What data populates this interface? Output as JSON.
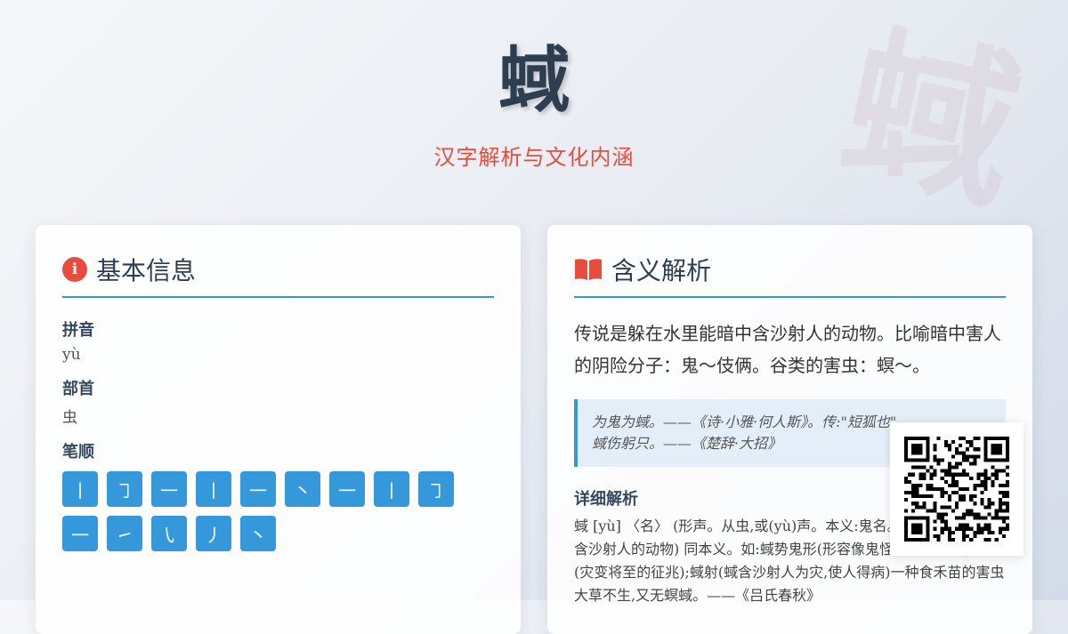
{
  "character": "蜮",
  "subtitle": "汉字解析与文化内涵",
  "colors": {
    "accent": "#3498db",
    "highlight": "#e74c3c",
    "text": "#2c3e50"
  },
  "basic": {
    "title": "基本信息",
    "icon": "info-icon",
    "pinyin_label": "拼音",
    "pinyin": "yù",
    "radical_label": "部首",
    "radical": "虫",
    "strokes_label": "笔顺",
    "strokes": [
      "丨",
      "㇆",
      "一",
      "丨",
      "一",
      "丶",
      "一",
      "丨",
      "㇆",
      "一",
      "㇀",
      "㇂",
      "丿",
      "丶"
    ]
  },
  "meaning": {
    "title": "含义解析",
    "icon": "book-icon",
    "description": "传说是躲在水里能暗中含沙射人的动物。比喻暗中害人的阴险分子：鬼～伎俩。谷类的害虫：螟～。",
    "quotes": [
      "为鬼为蜮。——《诗·小雅·何人斯》。传:\"短狐也\"",
      "蜮伤躬只。——《楚辞·大招》"
    ],
    "detail_title": "详细解析",
    "detail": "蜮 [yù] 〈名〉 (形声。从虫,或(yù)声。本义:鬼名。传说在水里暗中含沙射人的动物) 同本义。如:蜮势鬼形(形容像鬼怪般阴险可怕);蜮祥(灾变将至的征兆);蜮射(蜮含沙射人为灾,使人得病)一种食禾苗的害虫 大草不生,又无螟蜮。——《吕氏春秋》"
  }
}
